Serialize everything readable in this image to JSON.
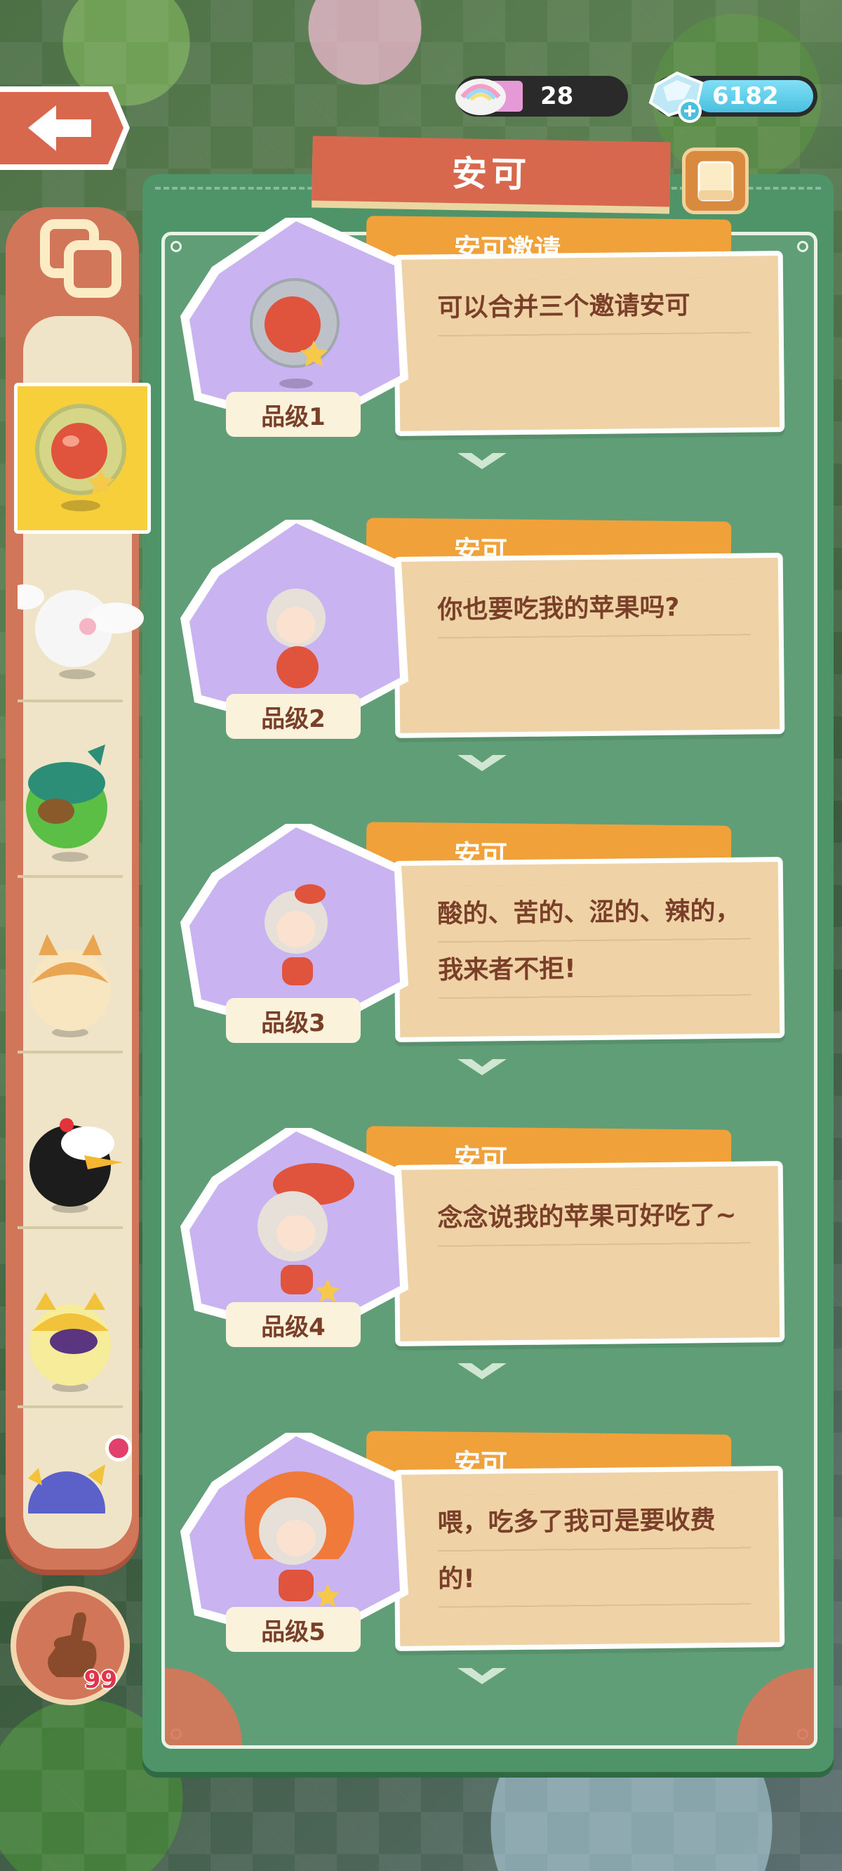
{
  "header": {
    "title": "安可",
    "currency_rainbow": "28",
    "currency_gem": "6182"
  },
  "colors": {
    "panel_green": "#4f9468",
    "title_red": "#d8684d",
    "name_tab_orange": "#f0a13a",
    "bubble_tan": "#efd2a6",
    "text_brown": "#7a3f28",
    "selected_yellow": "#f7cf3b",
    "hex_purple": "#c9b3f0"
  },
  "sidebar": {
    "items": [
      {
        "icon": "apple-bubble-icon",
        "selected": true
      },
      {
        "icon": "white-bird-icon"
      },
      {
        "icon": "green-parrot-icon"
      },
      {
        "icon": "shiba-dog-icon"
      },
      {
        "icon": "black-bird-icon"
      },
      {
        "icon": "yellow-cat-icon"
      },
      {
        "icon": "blue-creature-icon",
        "notification": true
      }
    ],
    "finger_count": "99"
  },
  "cards": [
    {
      "name": "安可邀请",
      "text": "可以合并三个邀请安可",
      "grade": "品级1",
      "icon": "apple-bubble-icon"
    },
    {
      "name": "安可",
      "text": "你也要吃我的苹果吗?",
      "grade": "品级2",
      "icon": "anke-level2-icon"
    },
    {
      "name": "安可",
      "text": "酸的、苦的、涩的、辣的，我来者不拒!",
      "grade": "品级3",
      "icon": "anke-level3-icon"
    },
    {
      "name": "安可",
      "text": "念念说我的苹果可好吃了~",
      "grade": "品级4",
      "icon": "anke-level4-icon"
    },
    {
      "name": "安可",
      "text": "喂，吃多了我可是要收费的!",
      "grade": "品级5",
      "icon": "anke-level5-icon"
    }
  ]
}
